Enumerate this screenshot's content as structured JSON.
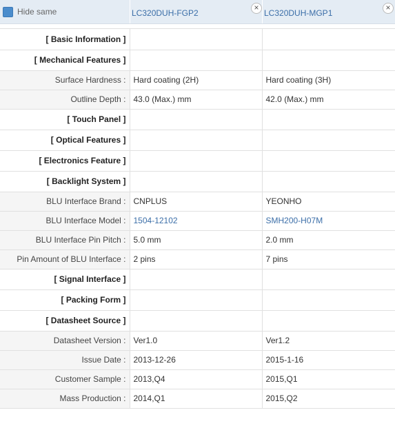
{
  "header": {
    "hide_same": "Hide same",
    "products": [
      {
        "name": "LC320DUH-FGP2",
        "close": "×"
      },
      {
        "name": "LC320DUH-MGP1",
        "close": "×"
      }
    ]
  },
  "sections": {
    "basic": "[ Basic Information ]",
    "mechanical": "[ Mechanical Features ]",
    "touch": "[ Touch Panel ]",
    "optical": "[ Optical Features ]",
    "electronics": "[ Electronics Feature ]",
    "backlight": "[ Backlight System ]",
    "signal": "[ Signal Interface ]",
    "packing": "[ Packing Form ]",
    "datasheet": "[ Datasheet Source ]"
  },
  "rows": {
    "surface_hardness": {
      "label": "Surface Hardness :",
      "v1": "Hard coating (2H)",
      "v2": "Hard coating (3H)"
    },
    "outline_depth": {
      "label": "Outline Depth :",
      "v1": "43.0 (Max.) mm",
      "v2": "42.0 (Max.) mm"
    },
    "blu_brand": {
      "label": "BLU Interface Brand :",
      "v1": "CNPLUS",
      "v2": "YEONHO"
    },
    "blu_model": {
      "label": "BLU Interface Model :",
      "v1": "1504-12102",
      "v2": "SMH200-H07M"
    },
    "blu_pitch": {
      "label": "BLU Interface Pin Pitch :",
      "v1": "5.0 mm",
      "v2": "2.0 mm"
    },
    "blu_pins": {
      "label": "Pin Amount of BLU Interface :",
      "v1": "2 pins",
      "v2": "7 pins"
    },
    "ds_version": {
      "label": "Datasheet Version :",
      "v1": "Ver1.0",
      "v2": "Ver1.2"
    },
    "issue_date": {
      "label": "Issue Date :",
      "v1": "2013-12-26",
      "v2": "2015-1-16"
    },
    "customer_sample": {
      "label": "Customer Sample :",
      "v1": "2013,Q4",
      "v2": "2015,Q1"
    },
    "mass_production": {
      "label": "Mass Production :",
      "v1": "2014,Q1",
      "v2": "2015,Q2"
    }
  },
  "colors": {
    "link": "#3b6ea8",
    "header_bg": "#e4ecf4",
    "checkbox": "#4a8ccc"
  }
}
